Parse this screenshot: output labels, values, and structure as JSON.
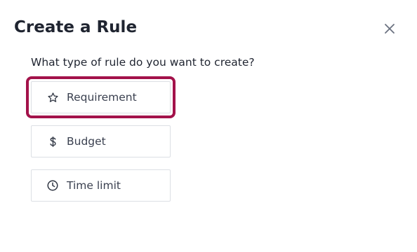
{
  "dialog": {
    "title": "Create a Rule",
    "close_icon": "close-icon",
    "prompt": "What type of rule do you want to create?"
  },
  "options": [
    {
      "label": "Requirement",
      "icon": "star-icon",
      "focused": true
    },
    {
      "label": "Budget",
      "icon": "dollar-icon",
      "focused": false
    },
    {
      "label": "Time limit",
      "icon": "clock-icon",
      "focused": false
    }
  ],
  "colors": {
    "focus_ring": "#a3124a",
    "text_primary": "#1f2430",
    "text_secondary": "#3b4150",
    "border": "#dcdfe4"
  }
}
